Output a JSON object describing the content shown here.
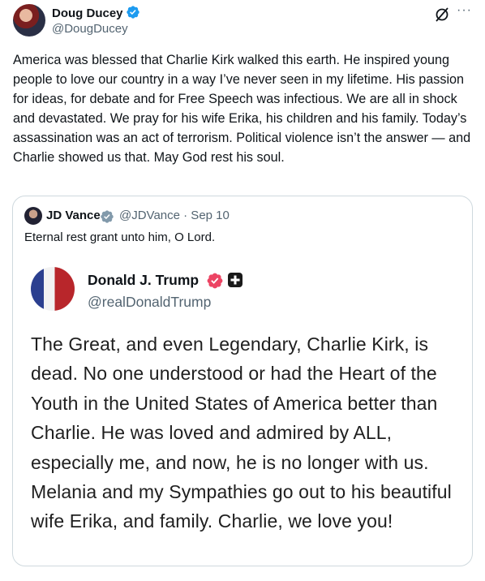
{
  "author": {
    "name": "Doug Ducey",
    "handle": "@DougDucey"
  },
  "tweet_text": "America was blessed that Charlie Kirk walked this earth. He inspired young people to love our country in a way I’ve never seen in my lifetime. His passion for ideas, for debate and for Free Speech was infectious. We are all in shock and devastated. We pray for his wife Erika, his children and his family. Today’s assassination was an act of terrorism. Political violence isn’t the answer — and Charlie showed us that. May God rest his soul.",
  "quoted": {
    "name": "JD Vance",
    "handle": "@JDVance · Sep 10",
    "text": "Eternal rest grant unto him, O Lord.",
    "embedded": {
      "name": "Donald J. Trump",
      "handle": "@realDonaldTrump",
      "text": "The Great, and even Legendary, Charlie Kirk, is dead. No one understood or had the Heart of the Youth in the United States of America better than Charlie. He was loved and admired by ALL, especially me, and now, he is no longer with us. Melania and my Sympathies go out to his beautiful wife Erika, and family. Charlie, we love you!"
    }
  },
  "icons": {
    "more": "more-icon",
    "grok": "grok-icon",
    "verified": "verified-icon"
  },
  "colors": {
    "verified_blue": "#1d9bf0",
    "truth_badge": "#ec4463",
    "secondary_text": "#536471"
  }
}
